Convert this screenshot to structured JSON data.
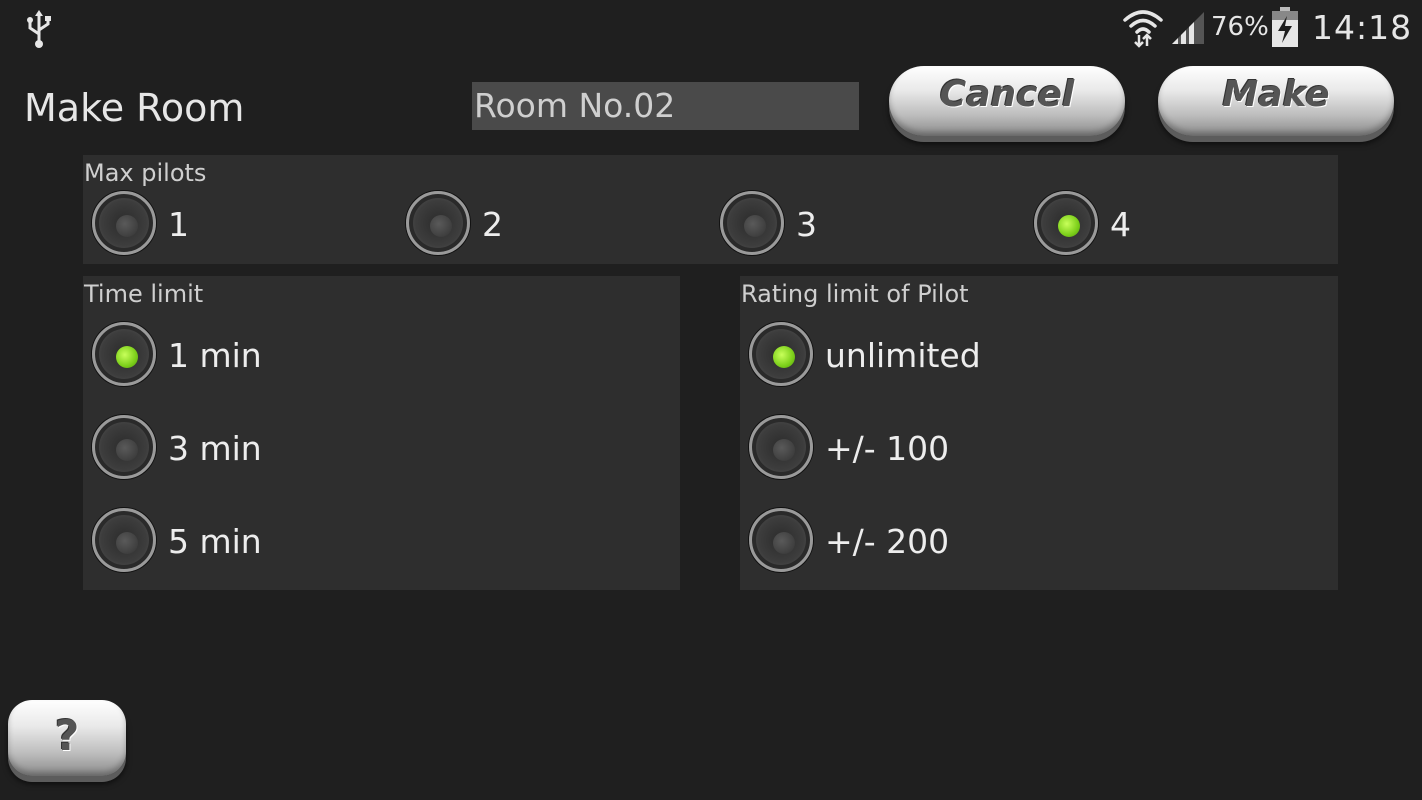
{
  "status_bar": {
    "battery_percent": "76%",
    "time": "14:18",
    "icons": [
      "usb-icon",
      "wifi-icon",
      "signal-icon",
      "battery-charging-icon"
    ]
  },
  "header": {
    "title": "Make Room",
    "room_name_value": "Room No.02",
    "cancel_label": "Cancel",
    "make_label": "Make"
  },
  "max_pilots": {
    "label": "Max pilots",
    "options": [
      "1",
      "2",
      "3",
      "4"
    ],
    "selected": "4"
  },
  "time_limit": {
    "label": "Time limit",
    "options": [
      "1 min",
      "3 min",
      "5 min"
    ],
    "selected": "1 min"
  },
  "rating_limit": {
    "label": "Rating limit of Pilot",
    "options": [
      "unlimited",
      "+/- 100",
      "+/- 200"
    ],
    "selected": "unlimited"
  },
  "help_label": "?",
  "colors": {
    "background": "#1f1f1f",
    "panel": "#2e2e2e",
    "radio_selected": "#8fe12a",
    "input_bg": "#4a4a4a"
  }
}
